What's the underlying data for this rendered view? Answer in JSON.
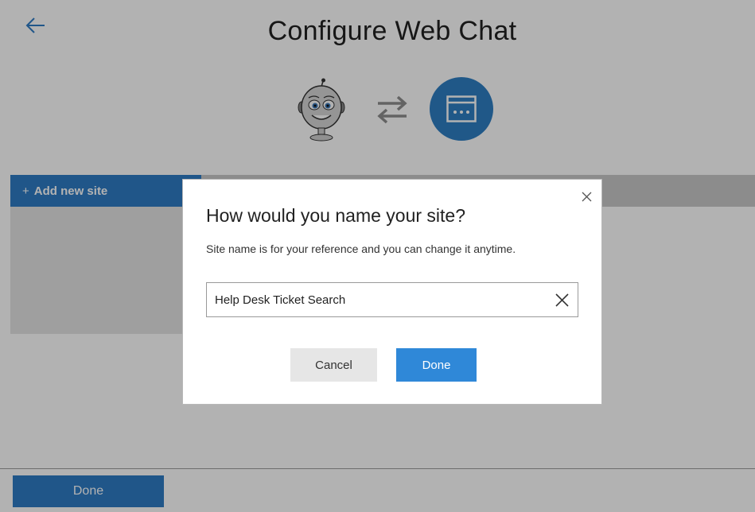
{
  "header": {
    "title": "Configure Web Chat",
    "back_icon": "arrow-left-icon"
  },
  "hero": {
    "bot_icon": "bot-avatar-icon",
    "swap_icon": "swap-arrows-icon",
    "channel_icon": "web-chat-window-icon"
  },
  "sites": {
    "add_label": "Add new site",
    "add_icon": "plus-icon"
  },
  "footer": {
    "done_label": "Done"
  },
  "dialog": {
    "title": "How would you name your site?",
    "description": "Site name is for your reference and you can change it anytime.",
    "input_value": "Help Desk Ticket Search",
    "cancel_label": "Cancel",
    "done_label": "Done",
    "close_icon": "close-icon",
    "clear_icon": "clear-icon"
  },
  "colors": {
    "accent": "#2f7cc5",
    "dialog_done": "#2f88d8",
    "overlay": "rgba(0,0,0,0.30)"
  }
}
